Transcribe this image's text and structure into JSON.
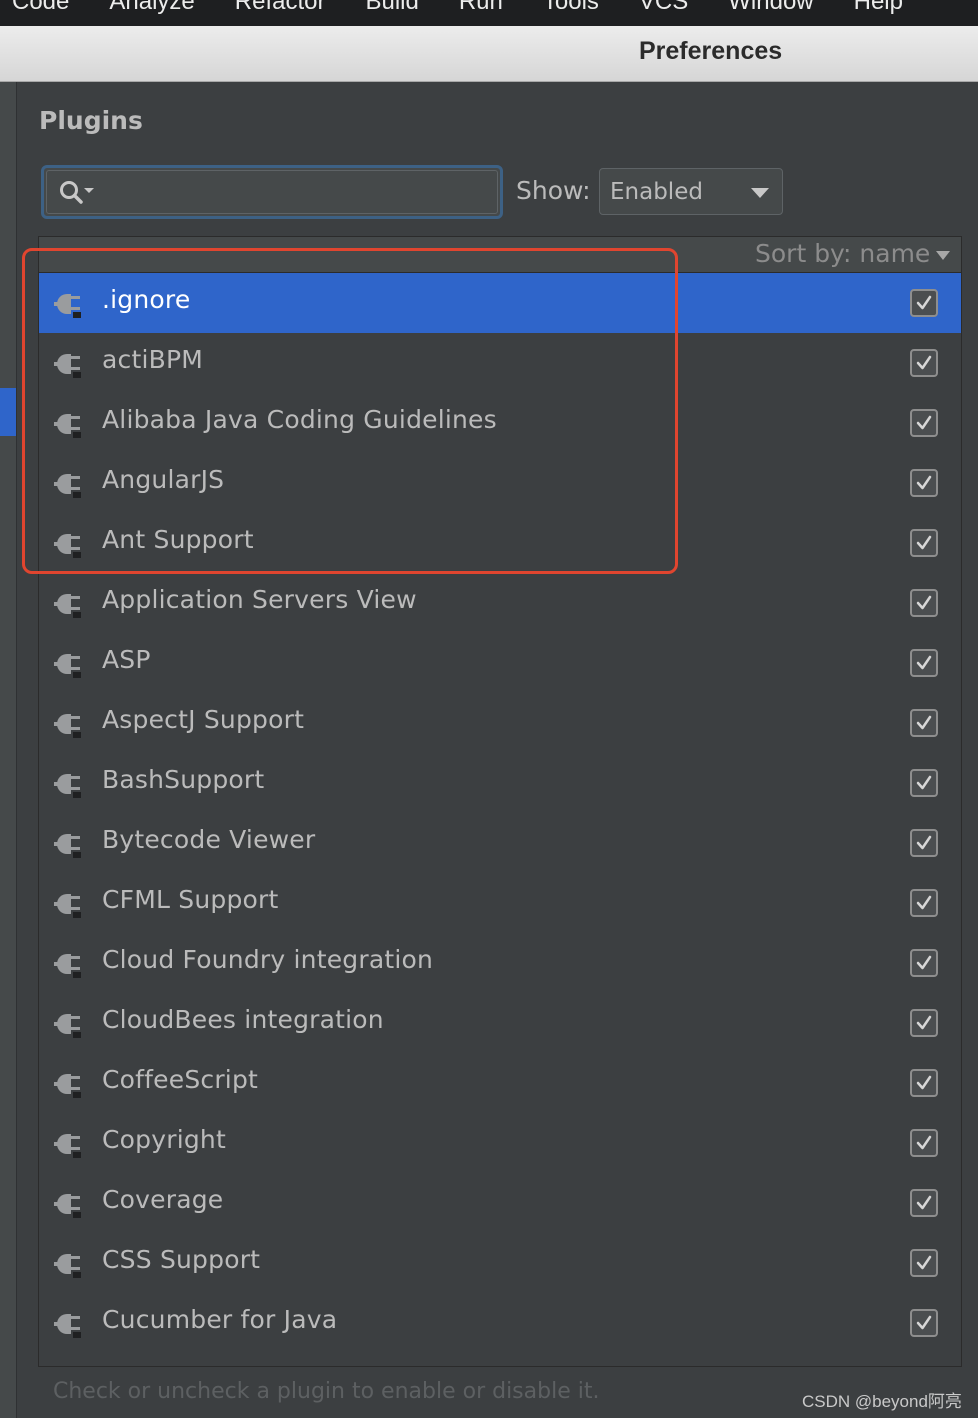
{
  "menubar": {
    "items": [
      "Code",
      "Analyze",
      "Refactor",
      "Build",
      "Run",
      "Tools",
      "VCS",
      "Window",
      "Help"
    ]
  },
  "window": {
    "title": "Preferences"
  },
  "plugins": {
    "heading": "Plugins",
    "search": {
      "value": "",
      "placeholder": "",
      "icon": "search-icon"
    },
    "show": {
      "label": "Show:",
      "selected": "Enabled"
    },
    "sort_label": "Sort by: name",
    "items": [
      {
        "name": ".ignore",
        "enabled": true,
        "selected": true
      },
      {
        "name": "actiBPM",
        "enabled": true
      },
      {
        "name": "Alibaba Java Coding Guidelines",
        "enabled": true
      },
      {
        "name": "AngularJS",
        "enabled": true
      },
      {
        "name": "Ant Support",
        "enabled": true
      },
      {
        "name": "Application Servers View",
        "enabled": true
      },
      {
        "name": "ASP",
        "enabled": true
      },
      {
        "name": "AspectJ Support",
        "enabled": true
      },
      {
        "name": "BashSupport",
        "enabled": true
      },
      {
        "name": "Bytecode Viewer",
        "enabled": true
      },
      {
        "name": "CFML Support",
        "enabled": true
      },
      {
        "name": "Cloud Foundry integration",
        "enabled": true
      },
      {
        "name": "CloudBees integration",
        "enabled": true
      },
      {
        "name": "CoffeeScript",
        "enabled": true
      },
      {
        "name": "Copyright",
        "enabled": true
      },
      {
        "name": "Coverage",
        "enabled": true
      },
      {
        "name": "CSS Support",
        "enabled": true
      },
      {
        "name": "Cucumber for Java",
        "enabled": true
      }
    ],
    "hint": "Check or uncheck a plugin to enable or disable it."
  },
  "watermark": "CSDN @beyond阿亮",
  "colors": {
    "selection": "#2f65ca",
    "panel_bg": "#3c3f41",
    "annotation_box": "#e0452f"
  }
}
